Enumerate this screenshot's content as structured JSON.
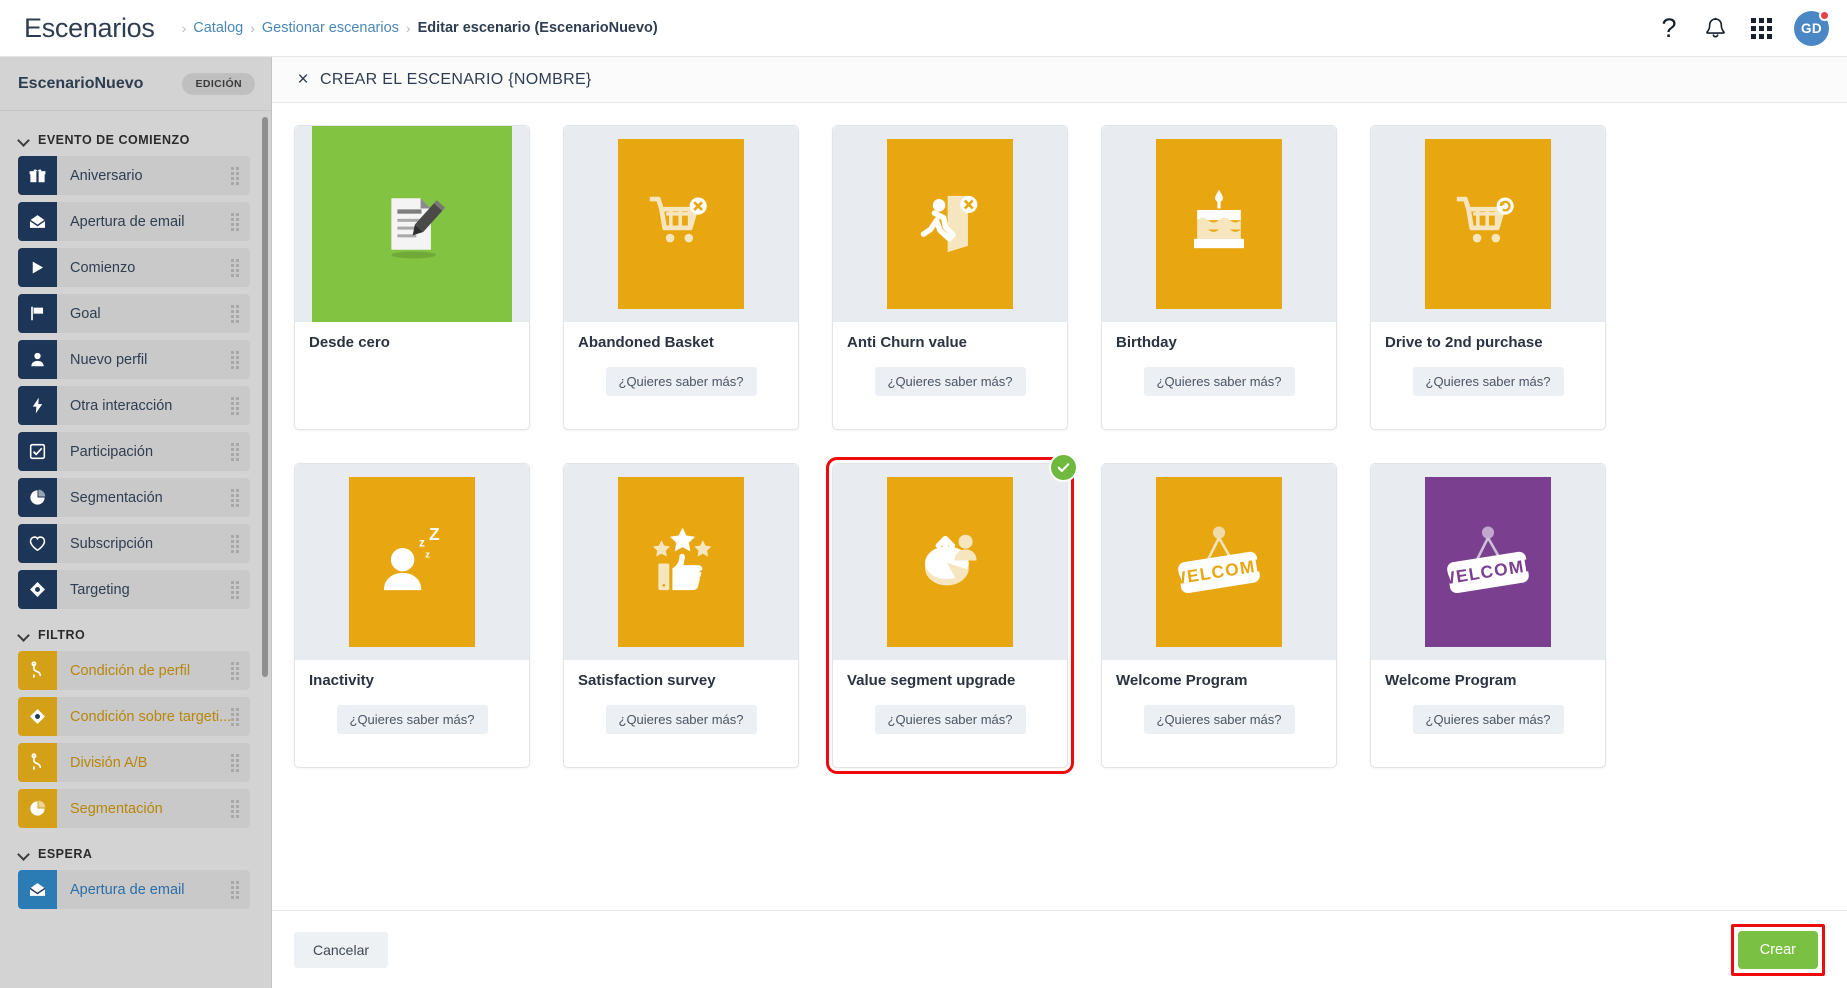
{
  "header": {
    "app_title": "Escenarios",
    "breadcrumb": [
      {
        "label": "Catalog",
        "current": false
      },
      {
        "label": "Gestionar escenarios",
        "current": false
      },
      {
        "label": "Editar escenario (EscenarioNuevo)",
        "current": true
      }
    ],
    "icons": {
      "help": "?",
      "help_name": "help-icon",
      "bell_name": "notifications-bell-icon",
      "apps_name": "apps-grid-icon"
    },
    "avatar_initials": "GD"
  },
  "sidebar": {
    "scenario_name": "EscenarioNuevo",
    "mode_badge": "EDICIÓN",
    "groups": [
      {
        "label": "EVENTO DE COMIENZO",
        "theme": "navy",
        "items": [
          {
            "label": "Aniversario",
            "icon": "gift-icon"
          },
          {
            "label": "Apertura de email",
            "icon": "open-envelope-icon"
          },
          {
            "label": "Comienzo",
            "icon": "play-icon"
          },
          {
            "label": "Goal",
            "icon": "flag-icon"
          },
          {
            "label": "Nuevo perfil",
            "icon": "person-icon"
          },
          {
            "label": "Otra interacción",
            "icon": "lightning-icon"
          },
          {
            "label": "Participación",
            "icon": "checkbox-icon"
          },
          {
            "label": "Segmentación",
            "icon": "pie-chart-icon"
          },
          {
            "label": "Subscripción",
            "icon": "heart-icon"
          },
          {
            "label": "Targeting",
            "icon": "target-diamond-icon"
          }
        ]
      },
      {
        "label": "FILTRO",
        "theme": "gold",
        "items": [
          {
            "label": "Condición de perfil",
            "icon": "branch-icon"
          },
          {
            "label": "Condición sobre targeti...",
            "icon": "target-diamond-icon"
          },
          {
            "label": "División A/B",
            "icon": "branch-icon"
          },
          {
            "label": "Segmentación",
            "icon": "pie-chart-icon"
          }
        ]
      },
      {
        "label": "ESPERA",
        "theme": "blue",
        "items": [
          {
            "label": "Apertura de email",
            "icon": "open-envelope-icon"
          }
        ]
      }
    ]
  },
  "modal": {
    "close_label": "×",
    "title": "CREAR EL ESCENARIO {NOMBRE}",
    "more_label": "¿Quieres saber más?",
    "cards": [
      {
        "name": "Desde cero",
        "tile_color": "#82c341",
        "icon": "document-pencil-icon",
        "has_more": false,
        "selected": false,
        "wide": true
      },
      {
        "name": "Abandoned Basket",
        "tile_color": "#e8a710",
        "icon": "cart-remove-icon",
        "has_more": true,
        "selected": false,
        "wide": false
      },
      {
        "name": "Anti Churn value",
        "tile_color": "#e8a710",
        "icon": "person-exit-icon",
        "has_more": true,
        "selected": false,
        "wide": false
      },
      {
        "name": "Birthday",
        "tile_color": "#e8a710",
        "icon": "birthday-cake-icon",
        "has_more": true,
        "selected": false,
        "wide": false
      },
      {
        "name": "Drive to 2nd purchase",
        "tile_color": "#e8a710",
        "icon": "cart-repeat-icon",
        "has_more": true,
        "selected": false,
        "wide": false
      },
      {
        "name": "Inactivity",
        "tile_color": "#e8a710",
        "icon": "sleeping-person-icon",
        "has_more": true,
        "selected": false,
        "wide": false
      },
      {
        "name": "Satisfaction survey",
        "tile_color": "#e8a710",
        "icon": "thumbs-up-stars-icon",
        "has_more": true,
        "selected": false,
        "wide": false
      },
      {
        "name": "Value segment upgrade",
        "tile_color": "#e8a710",
        "icon": "segment-upgrade-icon",
        "has_more": true,
        "selected": true,
        "wide": false
      },
      {
        "name": "Welcome Program",
        "tile_color": "#e8a710",
        "icon": "welcome-sign-icon",
        "has_more": true,
        "selected": false,
        "wide": false
      },
      {
        "name": "Welcome Program",
        "tile_color": "#7b3f8f",
        "icon": "welcome-sign-icon",
        "has_more": true,
        "selected": false,
        "wide": false
      }
    ],
    "footer": {
      "cancel_label": "Cancelar",
      "create_label": "Crear"
    }
  },
  "colors": {
    "accent_navy": "#1d3557",
    "accent_gold": "#d4a017",
    "accent_blue": "#2b7cb5",
    "create_green": "#7ac143",
    "highlight_red": "#ef0b0b",
    "check_green": "#6fb93f"
  }
}
